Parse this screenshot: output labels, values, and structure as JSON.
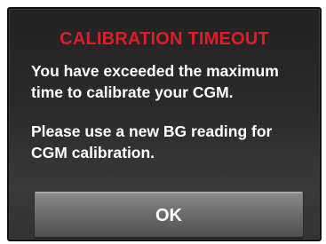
{
  "dialog": {
    "title": "CALIBRATION TIMEOUT",
    "message_line_1": "You have exceeded the maximum time to calibrate your CGM.",
    "message_line_2": "Please use a new BG reading for CGM calibration.",
    "ok_label": "OK"
  },
  "colors": {
    "title": "#d8202b",
    "text": "#ffffff",
    "background": "#2b2b2b",
    "button": "#6f6f6f"
  }
}
